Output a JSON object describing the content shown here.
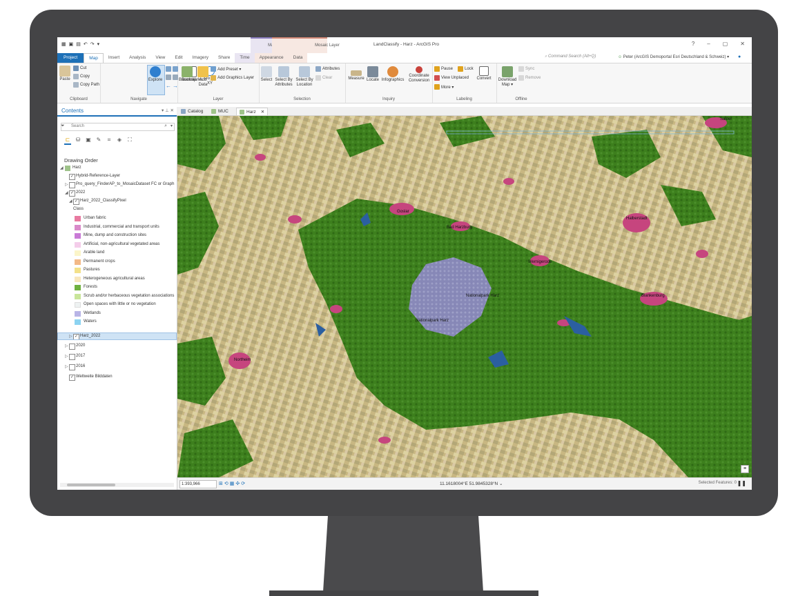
{
  "app": {
    "title": "LandClassify - Harz - ArcGIS Pro",
    "context_groups": {
      "map": "Map",
      "mosaic": "Mosaic Layer"
    },
    "window_controls": [
      "?",
      "–",
      "▢",
      "✕"
    ]
  },
  "tabs": [
    "Project",
    "Map",
    "Insert",
    "Analysis",
    "View",
    "Edit",
    "Imagery",
    "Share",
    "Time",
    "Appearance",
    "Data"
  ],
  "command_search": {
    "placeholder": "Command Search (Alt+Q)"
  },
  "user": {
    "name": "Peter (ArcGIS Demoportal Esri Deutschland & Schweiz) ▾"
  },
  "ribbon": {
    "clipboard": {
      "label": "Clipboard",
      "paste": "Paste",
      "cut": "Cut",
      "copy": "Copy",
      "copy_path": "Copy Path"
    },
    "navigate": {
      "label": "Navigate",
      "explore": "Explore",
      "bookmarks": "Bookmarks",
      "go_to_xy": "Go To XY"
    },
    "layer": {
      "label": "Layer",
      "basemap": "Basemap",
      "add_data": "Add Data",
      "add_preset": "Add Preset ▾",
      "add_graphics_layer": "Add Graphics Layer"
    },
    "selection": {
      "label": "Selection",
      "select": "Select",
      "select_by_attributes": "Select By Attributes",
      "select_by_location": "Select By Location",
      "attributes": "Attributes",
      "clear": "Clear"
    },
    "inquiry": {
      "label": "Inquiry",
      "measure": "Measure",
      "locate": "Locate",
      "infographics": "Infographics",
      "coordinate_conversion": "Coordinate Conversion"
    },
    "labeling": {
      "label": "Labeling",
      "pause": "Pause",
      "lock": "Lock",
      "view_unplaced": "View Unplaced",
      "more": "More ▾",
      "convert": "Convert"
    },
    "offline": {
      "label": "Offline",
      "download_map": "Download Map ▾",
      "sync": "Sync",
      "remove": "Remove"
    }
  },
  "contents": {
    "title": "Contents",
    "search_placeholder": "Search",
    "drawing_order": "Drawing Order",
    "map_name": "Harz",
    "layers": [
      {
        "label": "Hybrid-Reference-Layer",
        "checked": true
      },
      {
        "label": "Pro_query_FinderAP_to_MosaicDataset FC or Graph",
        "checked": false
      },
      {
        "label": "2022",
        "checked": true
      },
      {
        "label": "Harz_2022_ClassifyPixel",
        "checked": true
      }
    ],
    "class_heading": "Class",
    "classes": [
      {
        "label": "Urban fabric",
        "color": "#e87aa0"
      },
      {
        "label": "Industrial, commercial and transport units",
        "color": "#d98ac9"
      },
      {
        "label": "Mine, dump and construction sites",
        "color": "#c97ad6"
      },
      {
        "label": "Artificial, non-agricultural vegetated areas",
        "color": "#f4cdea"
      },
      {
        "label": "Arable land",
        "color": "#fbf5c9"
      },
      {
        "label": "Permanent crops",
        "color": "#f3b987"
      },
      {
        "label": "Pastures",
        "color": "#f3e18a"
      },
      {
        "label": "Heterogeneous agricultural areas",
        "color": "#f8e7bd"
      },
      {
        "label": "Forests",
        "color": "#6fb13f"
      },
      {
        "label": "Scrub and/or herbaceous vegetation associations",
        "color": "#c9e59a"
      },
      {
        "label": "Open spaces with little or no vegetation",
        "color": "#eef2f2"
      },
      {
        "label": "Wetlands",
        "color": "#b8b4e6"
      },
      {
        "label": "Waters",
        "color": "#8cd3f1"
      }
    ],
    "more_layers": [
      {
        "label": "Harz_2022",
        "checked": true
      },
      {
        "label": "2020",
        "checked": false
      },
      {
        "label": "2017",
        "checked": false
      },
      {
        "label": "2016",
        "checked": false
      },
      {
        "label": "Weltweite Bilddaten",
        "checked": true
      }
    ]
  },
  "doc_tabs": [
    "Catalog",
    "MUC",
    "Harz"
  ],
  "map_labels": [
    {
      "text": "Goslar"
    },
    {
      "text": "Bad Harzburg"
    },
    {
      "text": "Halberstadt"
    },
    {
      "text": "Wernigerode"
    },
    {
      "text": "Nationalpark Harz"
    },
    {
      "text": "Nationalpark Harz"
    },
    {
      "text": "Blankenburg"
    },
    {
      "text": "Northeim"
    },
    {
      "text": "Salder"
    }
  ],
  "status": {
    "scale": "1:393,966",
    "coordinates": "11.1618004°E 51.9845328°N",
    "selected_features": "Selected Features: 0"
  },
  "colors": {
    "accent": "#1d70b7",
    "forest": "#3f7f1c",
    "urban": "#c6457e",
    "wetland": "#8c86c8"
  }
}
